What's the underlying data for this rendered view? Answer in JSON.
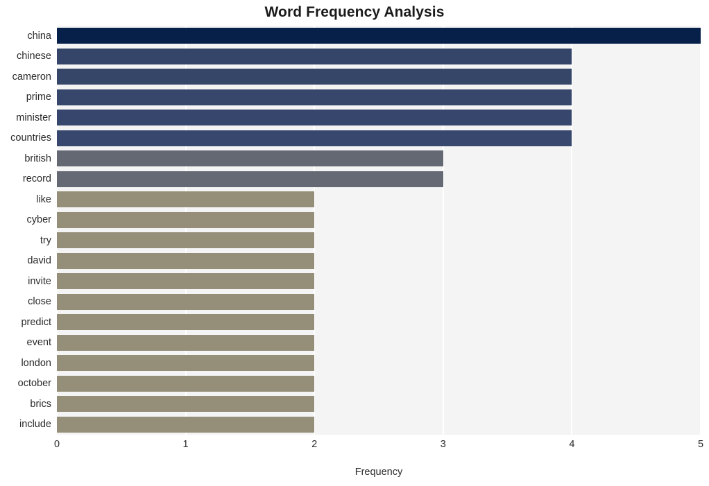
{
  "chart_data": {
    "type": "bar",
    "orientation": "horizontal",
    "title": "Word Frequency Analysis",
    "xlabel": "Frequency",
    "ylabel": "",
    "xlim": [
      0,
      5
    ],
    "xticks": [
      "0",
      "1",
      "2",
      "3",
      "4",
      "5"
    ],
    "grid": true,
    "grid_axis": "x",
    "legend": "none",
    "categories": [
      "china",
      "chinese",
      "cameron",
      "prime",
      "minister",
      "countries",
      "british",
      "record",
      "like",
      "cyber",
      "try",
      "david",
      "invite",
      "close",
      "predict",
      "event",
      "london",
      "october",
      "brics",
      "include"
    ],
    "values": [
      5,
      4,
      4,
      4,
      4,
      4,
      3,
      3,
      2,
      2,
      2,
      2,
      2,
      2,
      2,
      2,
      2,
      2,
      2,
      2
    ],
    "bar_colors": [
      "#06204a",
      "#344569",
      "#364669",
      "#37466b",
      "#37466c",
      "#38476d",
      "#646873",
      "#656974",
      "#958f79",
      "#958f79",
      "#958f79",
      "#958f79",
      "#958f79",
      "#958f79",
      "#958f79",
      "#958f79",
      "#958f79",
      "#958f79",
      "#958f79",
      "#958f79"
    ],
    "plot_background": "#f4f4f5",
    "gridline_color": "#ffffff",
    "title_color": "#1a1a1a",
    "tick_color": "#2b2b2b"
  }
}
